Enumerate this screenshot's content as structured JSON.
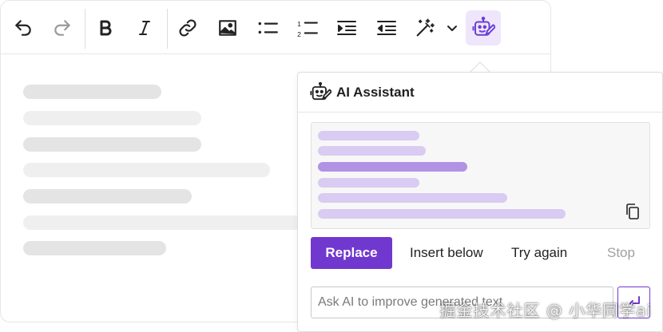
{
  "toolbar": {
    "buttons": [
      {
        "id": "undo",
        "icon": "undo-icon"
      },
      {
        "id": "redo",
        "icon": "redo-icon",
        "state": "disabled"
      },
      {
        "id": "bold",
        "icon": "bold-icon"
      },
      {
        "id": "italic",
        "icon": "italic-icon"
      },
      {
        "id": "link",
        "icon": "link-icon"
      },
      {
        "id": "image",
        "icon": "image-icon"
      },
      {
        "id": "bulleted-list",
        "icon": "bulleted-list-icon"
      },
      {
        "id": "numbered-list",
        "icon": "numbered-list-icon"
      },
      {
        "id": "indent",
        "icon": "indent-icon"
      },
      {
        "id": "outdent",
        "icon": "outdent-icon"
      },
      {
        "id": "ai-commands",
        "icon": "magic-wand-icon"
      },
      {
        "id": "ai-commands-dropdown",
        "icon": "chevron-down-icon"
      },
      {
        "id": "ai-assistant",
        "icon": "robot-pen-icon",
        "state": "active"
      }
    ]
  },
  "ai_panel": {
    "title": "AI Assistant",
    "title_icon": "robot-pen-icon",
    "copy_icon": "copy-icon",
    "actions": {
      "replace": "Replace",
      "insert_below": "Insert below",
      "try_again": "Try again",
      "stop": "Stop"
    },
    "input_placeholder": "Ask AI to improve generated text",
    "send_icon": "send-icon"
  },
  "watermark": "掘金技术社区 @ 小华同学ai",
  "colors": {
    "accent": "#7138cf",
    "accent_light": "#efe6fb",
    "skeleton": "#e4e4e4",
    "response_line": "#d9cbf2",
    "response_line_strong": "#b192e4"
  }
}
